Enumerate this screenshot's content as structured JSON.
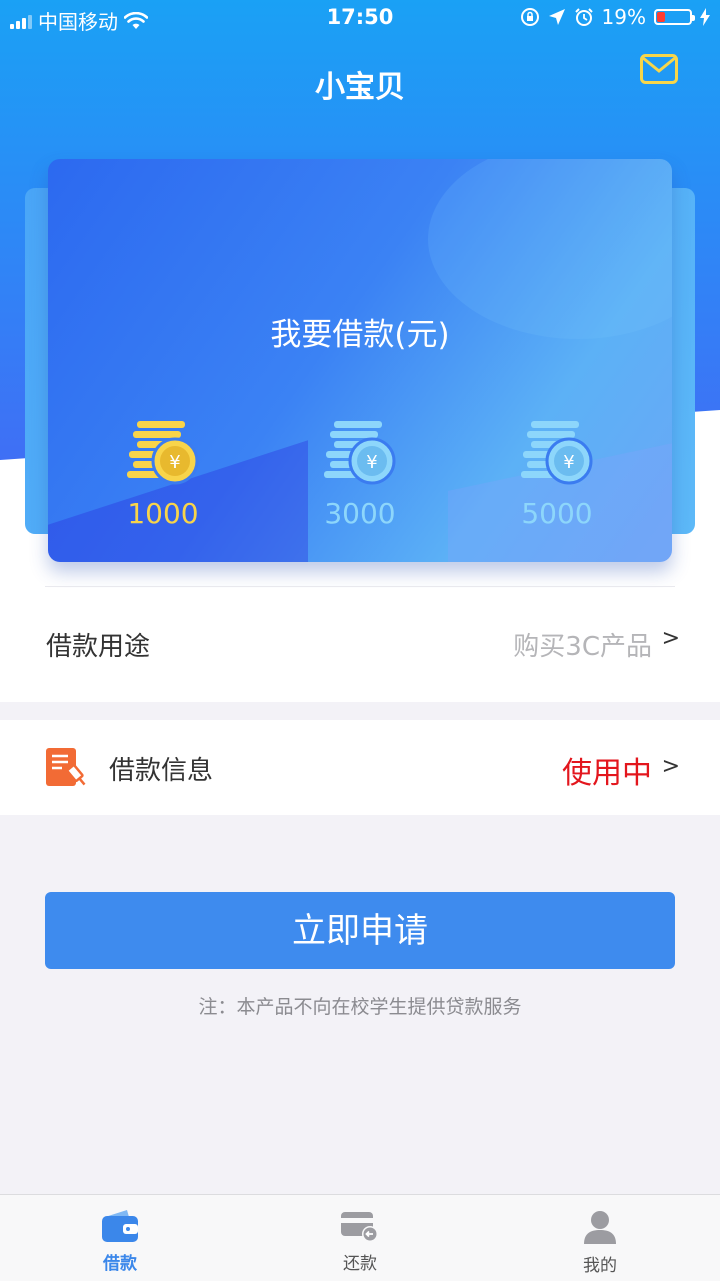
{
  "status_bar": {
    "carrier": "中国移动",
    "time": "17:50",
    "battery_pct": "19%"
  },
  "header": {
    "title": "小宝贝"
  },
  "card": {
    "title": "我要借款(元)",
    "amounts": [
      {
        "label": "1000",
        "color": "#f8d44a",
        "selected": true
      },
      {
        "label": "3000",
        "color": "#8dd6fb",
        "selected": false
      },
      {
        "label": "5000",
        "color": "#8dd6fb",
        "selected": false
      }
    ]
  },
  "purpose": {
    "label": "借款用途",
    "value": "购买3C产品",
    "chevron": ">"
  },
  "info": {
    "label": "借款信息",
    "status": "使用中",
    "chevron": ">"
  },
  "apply_button": "立即申请",
  "note": "注：本产品不向在校学生提供贷款服务",
  "tabs": [
    {
      "label": "借款",
      "icon": "wallet-icon",
      "active": true
    },
    {
      "label": "还款",
      "icon": "card-refund-icon",
      "active": false
    },
    {
      "label": "我的",
      "icon": "user-icon",
      "active": false
    }
  ]
}
